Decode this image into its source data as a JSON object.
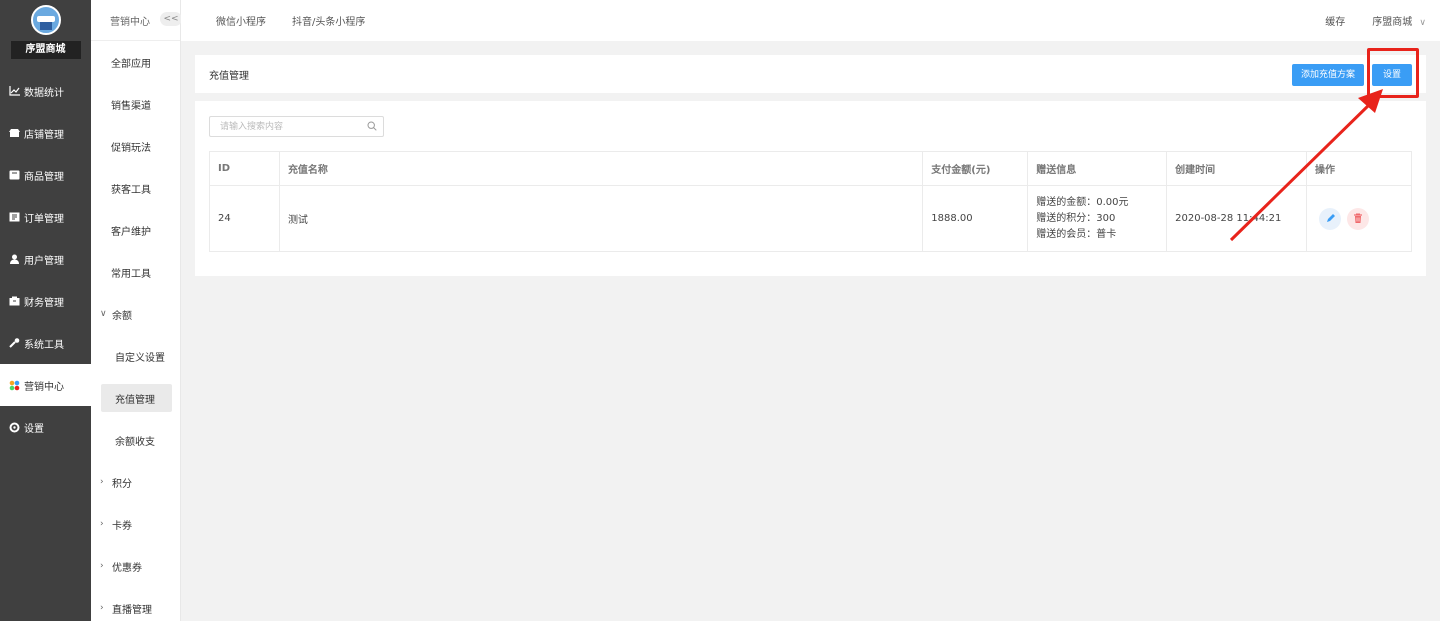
{
  "app": {
    "store_name": "序盟商城",
    "accent_color": "#3a9df5",
    "sidebar_color": "#404040",
    "highlight_color": "#e8231b"
  },
  "sidebar": {
    "items": [
      {
        "label": "数据统计",
        "icon": "chart-line-icon"
      },
      {
        "label": "店铺管理",
        "icon": "store-icon"
      },
      {
        "label": "商品管理",
        "icon": "goods-icon"
      },
      {
        "label": "订单管理",
        "icon": "order-icon"
      },
      {
        "label": "用户管理",
        "icon": "user-icon"
      },
      {
        "label": "财务管理",
        "icon": "finance-icon"
      },
      {
        "label": "系统工具",
        "icon": "wrench-icon"
      },
      {
        "label": "营销中心",
        "icon": "marketing-icon"
      },
      {
        "label": "设置",
        "icon": "gear-icon"
      }
    ]
  },
  "subnav": {
    "title": "营销中心",
    "collapse_label": "<<",
    "items": [
      "全部应用",
      "销售渠道",
      "促销玩法",
      "获客工具",
      "客户维护",
      "常用工具"
    ],
    "balance_group": "余额",
    "balance_children": [
      "自定义设置",
      "充值管理",
      "余额收支"
    ],
    "collapsed_groups": [
      "积分",
      "卡券",
      "优惠券",
      "直播管理"
    ]
  },
  "topbar": {
    "tabs": [
      "微信小程序",
      "抖音/头条小程序"
    ],
    "cache": "缓存",
    "store": "序盟商城"
  },
  "header": {
    "title": "充值管理",
    "add_button": "添加充值方案",
    "settings_button": "设置"
  },
  "search": {
    "placeholder": "请输入搜索内容"
  },
  "table": {
    "headers": [
      "ID",
      "充值名称",
      "支付金额(元)",
      "赠送信息",
      "创建时间",
      "操作"
    ],
    "rows": [
      {
        "id": "24",
        "name": "测试",
        "amount": "1888.00",
        "gift_amount": "赠送的金额：0.00元",
        "gift_points": "赠送的积分：300",
        "gift_member": "赠送的会员：普卡",
        "created": "2020-08-28 11:44:21"
      }
    ]
  }
}
